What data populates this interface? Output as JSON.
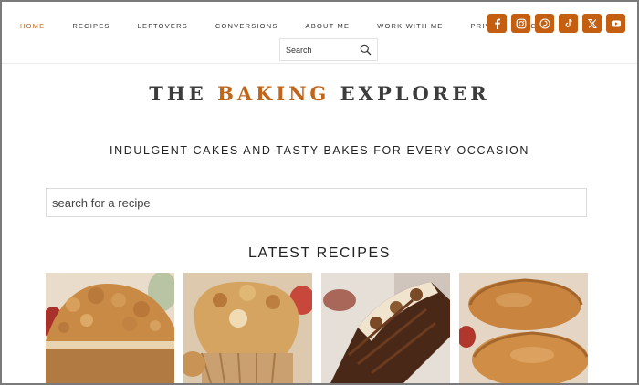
{
  "nav": {
    "items": [
      {
        "label": "HOME",
        "active": true
      },
      {
        "label": "RECIPES",
        "active": false
      },
      {
        "label": "LEFTOVERS",
        "active": false
      },
      {
        "label": "CONVERSIONS",
        "active": false
      },
      {
        "label": "ABOUT ME",
        "active": false
      },
      {
        "label": "WORK WITH ME",
        "active": false
      },
      {
        "label": "PRIVACY POLICY",
        "active": false
      }
    ],
    "accent_color": "#c0651a"
  },
  "social": {
    "icons": [
      "facebook-icon",
      "instagram-icon",
      "pinterest-icon",
      "tiktok-icon",
      "x-icon",
      "youtube-icon"
    ],
    "color": "#c45f12"
  },
  "header_search": {
    "label": "Search",
    "icon": "search-icon"
  },
  "brand": {
    "part1": "THE ",
    "accent": "BAKING",
    "part2": " EXPLORER"
  },
  "tagline": "INDULGENT CAKES AND TASTY BAKES FOR EVERY OCCASION",
  "recipe_search": {
    "placeholder": "search for a recipe"
  },
  "latest": {
    "heading": "LATEST RECIPES",
    "cards": [
      "crumble-cake-image",
      "muffin-image",
      "chocolate-log-image",
      "pasty-image"
    ]
  }
}
